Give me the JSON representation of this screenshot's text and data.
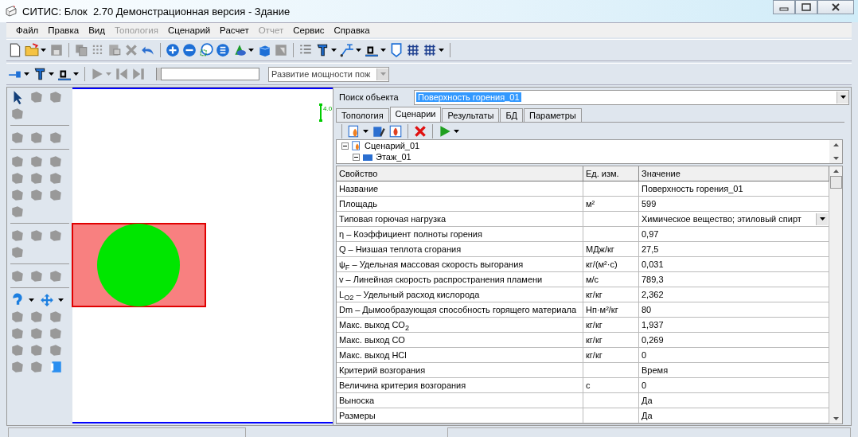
{
  "window": {
    "title": "СИТИС: Блок  2.70 Демонстрационная версия - Здание"
  },
  "menu": [
    {
      "label": "Файл",
      "disabled": false
    },
    {
      "label": "Правка",
      "disabled": false
    },
    {
      "label": "Вид",
      "disabled": false
    },
    {
      "label": "Топология",
      "disabled": true
    },
    {
      "label": "Сценарий",
      "disabled": false
    },
    {
      "label": "Расчет",
      "disabled": false
    },
    {
      "label": "Отчет",
      "disabled": true
    },
    {
      "label": "Сервис",
      "disabled": false
    },
    {
      "label": "Справка",
      "disabled": false
    }
  ],
  "playback_bar": {
    "timeline": {
      "level": 0
    },
    "scenario_combo": {
      "value": "Развитие мощности пож"
    }
  },
  "canvas": {
    "marker_label": "4.0"
  },
  "object_search": {
    "label": "Поиск объекта",
    "value": "Поверхность горения_01"
  },
  "tabs": [
    {
      "label": "Топология",
      "selected": false
    },
    {
      "label": "Сценарии",
      "selected": true
    },
    {
      "label": "Результаты",
      "selected": false
    },
    {
      "label": "БД",
      "selected": false
    },
    {
      "label": "Параметры",
      "selected": false
    }
  ],
  "scenario_tree": [
    {
      "label": "Сценарий_01",
      "expanded": true,
      "children": [
        {
          "label": "Этаж_01",
          "expanded": true
        }
      ]
    }
  ],
  "property_grid": {
    "columns": [
      "Свойство",
      "Ед. изм.",
      "Значение"
    ],
    "rows": [
      {
        "property": "Название",
        "unit": "",
        "value": "Поверхность горения_01",
        "kind": "text"
      },
      {
        "property": "Площадь",
        "unit": "м²",
        "value": "599",
        "kind": "text"
      },
      {
        "property": "Типовая горючая нагрузка",
        "unit": "",
        "value": "Химическое вещество; этиловый спирт",
        "kind": "dropdown"
      },
      {
        "property": "η – Коэффициент полноты горения",
        "unit": "",
        "value": "0,97",
        "kind": "text"
      },
      {
        "property": "Q – Низшая теплота сгорания",
        "unit": "МДж/кг",
        "value": "27,5",
        "kind": "text"
      },
      {
        "property": "ψ$_{F}$ – Удельная массовая скорость выгорания",
        "unit": "кг/(м²·с)",
        "value": "0,031",
        "kind": "text"
      },
      {
        "property": "v – Линейная скорость распространения пламени",
        "unit": "м/с",
        "value": "789,3",
        "kind": "text"
      },
      {
        "property": "L$_{O2}$ – Удельный расход кислорода",
        "unit": "кг/кг",
        "value": "2,362",
        "kind": "text"
      },
      {
        "property": "Dm – Дымообразующая способность горящего материала",
        "unit": "Нп·м²/кг",
        "value": "80",
        "kind": "text"
      },
      {
        "property": "Макс. выход CO$_{2}$",
        "unit": "кг/кг",
        "value": "1,937",
        "kind": "text"
      },
      {
        "property": "Макс. выход CO",
        "unit": "кг/кг",
        "value": "0,269",
        "kind": "text"
      },
      {
        "property": "Макс. выход HCl",
        "unit": "кг/кг",
        "value": "0",
        "kind": "text"
      },
      {
        "property": "Критерий возгорания",
        "unit": "",
        "value": "Время",
        "kind": "text"
      },
      {
        "property": "Величина критерия возгорания",
        "unit": "с",
        "value": "0",
        "kind": "text"
      },
      {
        "property": "Выноска",
        "unit": "",
        "value": "Да",
        "kind": "text"
      },
      {
        "property": "Размеры",
        "unit": "",
        "value": "Да",
        "kind": "text"
      }
    ]
  }
}
